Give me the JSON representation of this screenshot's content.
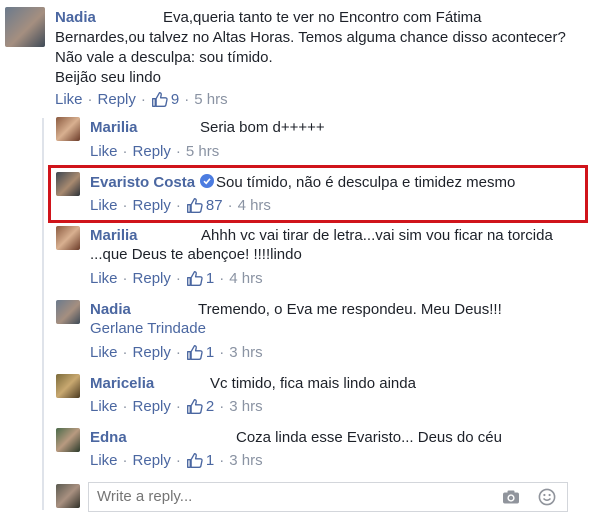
{
  "actions": {
    "like": "Like",
    "reply": "Reply",
    "dot": "·"
  },
  "comments": [
    {
      "name": "Nadia",
      "lines": [
        "Eva,queria tanto te ver no Encontro com Fátima",
        "Bernardes,ou talvez no Altas Horas. Temos alguma chance disso acontecer?",
        "Não vale a desculpa: sou tímido.",
        "Beijão seu lindo"
      ],
      "likes": "9",
      "time": "5 hrs"
    },
    {
      "name": "Marilia",
      "lines": [
        "Seria bom d+++++"
      ],
      "likes": "",
      "time": "5 hrs"
    },
    {
      "name": "Evaristo Costa",
      "lines": [
        "Sou tímido, não é desculpa e timidez mesmo"
      ],
      "likes": "87",
      "time": "4 hrs",
      "verified": true
    },
    {
      "name": "Marilia",
      "lines": [
        "Ahhh vc vai tirar de letra...vai sim vou ficar na torcida",
        "...que Deus te abençoe! !!!!lindo"
      ],
      "likes": "1",
      "time": "4 hrs"
    },
    {
      "name": "Nadia",
      "lines": [
        "Tremendo, o Eva me respondeu. Meu Deus!!!",
        "Gerlane Trindade"
      ],
      "likes": "1",
      "time": "3 hrs"
    },
    {
      "name": "Maricelia",
      "lines": [
        "Vc timido, fica mais lindo ainda"
      ],
      "likes": "2",
      "time": "3 hrs"
    },
    {
      "name": "Edna",
      "lines": [
        "Coza linda esse Evaristo... Deus do céu"
      ],
      "likes": "1",
      "time": "3 hrs"
    }
  ],
  "reply_box": {
    "placeholder": "Write a reply..."
  },
  "colors": {
    "name": "#4b67a1",
    "highlight": "#d0141b",
    "meta": "#8a93a3"
  },
  "icons": [
    "thumbs-up-icon",
    "verified-badge-icon",
    "camera-icon",
    "smiley-icon"
  ]
}
